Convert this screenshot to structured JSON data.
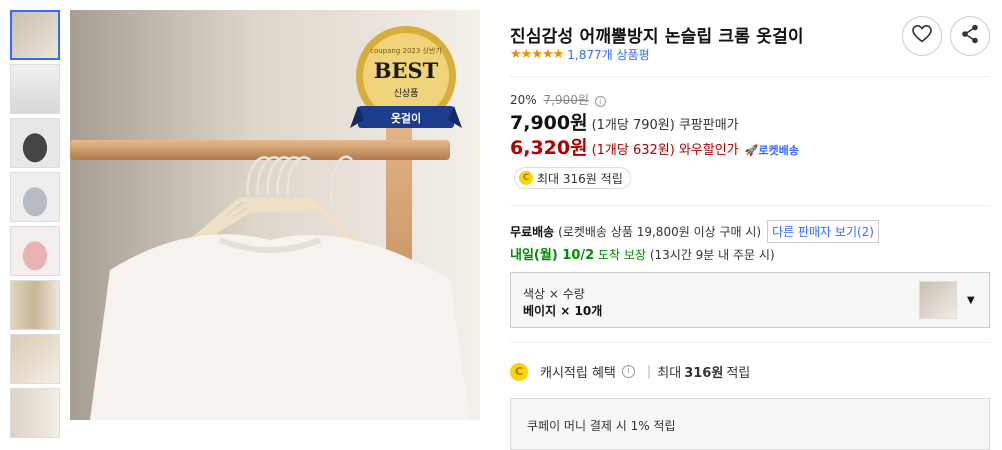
{
  "product": {
    "title": "진심감성 어깨뿔방지 논슬립 크롬 옷걸이",
    "review_count": "1,877개 상품평",
    "rating": 5
  },
  "badge": {
    "brand": "coupang",
    "year_text": "2023 상반기",
    "main": "BEST",
    "sub": "신상품",
    "ribbon": "옷걸이"
  },
  "price": {
    "discount_rate": "20%",
    "original_price": "7,900원",
    "sale_price": "7,900원",
    "sale_unit": "(1개당 790원)",
    "sale_label": "쿠팡판매가",
    "wow_price": "6,320원",
    "wow_unit": "(1개당 632원)",
    "wow_label": "와우할인가",
    "rocket_label": "로켓배송"
  },
  "reward_pill": "최대 316원 적립",
  "shipping": {
    "free": "무료배송",
    "condition": "(로켓배송 상품 19,800원 이상 구매 시)",
    "other_seller": "다른 판매자 보기(2)"
  },
  "arrival": {
    "date": "내일(월) 10/2",
    "guarantee": "도착 보장",
    "note": "(13시간 9분 내 주문 시)"
  },
  "option": {
    "label": "색상 × 수량",
    "value": "베이지 × 10개"
  },
  "cashback": {
    "label": "캐시적립 혜택",
    "max": "최대",
    "amount": "316원",
    "suffix": "적립"
  },
  "cpay_note": "쿠페이 머니 결제 시 1% 적립",
  "colors": {
    "accent": "#346aff",
    "wow_red": "#ae0000",
    "star": "#f28b00",
    "arrival_green": "#008c00"
  },
  "icons": [
    "heart-icon",
    "share-icon",
    "info-icon",
    "coin-icon",
    "rocket-icon",
    "chevron-down-icon"
  ]
}
